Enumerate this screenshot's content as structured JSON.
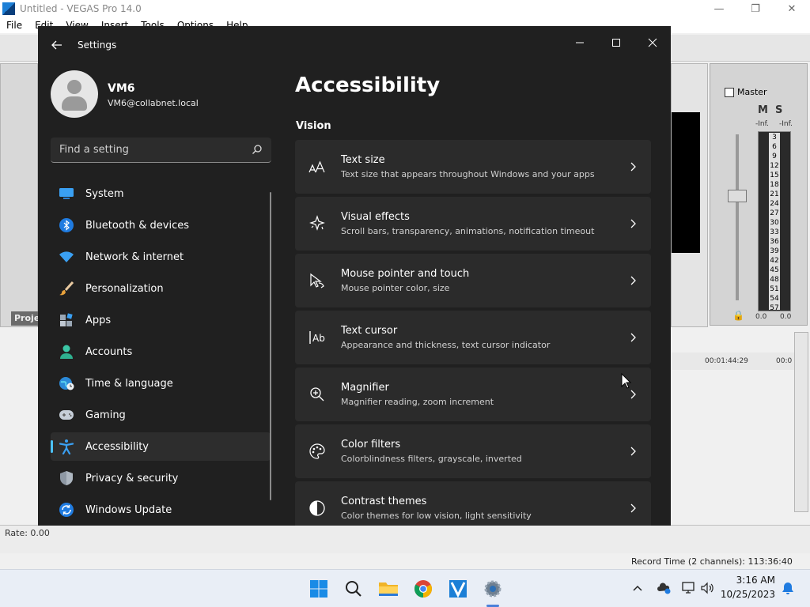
{
  "vegas": {
    "title": "Untitled - VEGAS Pro 14.0",
    "menu": [
      "File",
      "Edit",
      "View",
      "Insert",
      "Tools",
      "Options",
      "Help"
    ],
    "project_tab": "Proje",
    "master_label": "Master",
    "mute_label": "M",
    "solo_label": "S",
    "inf_left": "-Inf.",
    "inf_right": "-Inf.",
    "meter_scale": [
      "3",
      "6",
      "9",
      "12",
      "15",
      "18",
      "21",
      "24",
      "27",
      "30",
      "33",
      "36",
      "39",
      "42",
      "45",
      "48",
      "51",
      "54",
      "57"
    ],
    "meter_left_value": "0.0",
    "meter_right_value": "0.0",
    "timeline_time": "00:01:44:29",
    "timeline_time_2": "00:0",
    "rate_label": "Rate: 0.00",
    "record_time": "Record Time (2 channels): 113:36:40"
  },
  "settings": {
    "window_title": "Settings",
    "user": {
      "name": "VM6",
      "email": "VM6@collabnet.local"
    },
    "search_placeholder": "Find a setting",
    "nav": [
      {
        "label": "System",
        "icon": "monitor-icon"
      },
      {
        "label": "Bluetooth & devices",
        "icon": "bluetooth-icon"
      },
      {
        "label": "Network & internet",
        "icon": "wifi-icon"
      },
      {
        "label": "Personalization",
        "icon": "paintbrush-icon"
      },
      {
        "label": "Apps",
        "icon": "apps-icon"
      },
      {
        "label": "Accounts",
        "icon": "person-icon"
      },
      {
        "label": "Time & language",
        "icon": "globe-clock-icon"
      },
      {
        "label": "Gaming",
        "icon": "gamepad-icon"
      },
      {
        "label": "Accessibility",
        "icon": "accessibility-icon",
        "active": true
      },
      {
        "label": "Privacy & security",
        "icon": "shield-icon"
      },
      {
        "label": "Windows Update",
        "icon": "update-icon"
      }
    ],
    "page_title": "Accessibility",
    "section_title": "Vision",
    "cards": [
      {
        "title": "Text size",
        "desc": "Text size that appears throughout Windows and your apps",
        "icon": "text-size-icon"
      },
      {
        "title": "Visual effects",
        "desc": "Scroll bars, transparency, animations, notification timeout",
        "icon": "sparkle-icon"
      },
      {
        "title": "Mouse pointer and touch",
        "desc": "Mouse pointer color, size",
        "icon": "pointer-icon"
      },
      {
        "title": "Text cursor",
        "desc": "Appearance and thickness, text cursor indicator",
        "icon": "text-cursor-icon"
      },
      {
        "title": "Magnifier",
        "desc": "Magnifier reading, zoom increment",
        "icon": "magnifier-icon"
      },
      {
        "title": "Color filters",
        "desc": "Colorblindness filters, grayscale, inverted",
        "icon": "palette-icon"
      },
      {
        "title": "Contrast themes",
        "desc": "Color themes for low vision, light sensitivity",
        "icon": "contrast-icon"
      }
    ],
    "accent_color": "#4cc2ff"
  },
  "taskbar": {
    "time": "3:16 AM",
    "date": "10/25/2023",
    "apps": [
      "windows-start-icon",
      "search-icon",
      "file-explorer-icon",
      "chrome-icon",
      "vegas-icon",
      "settings-gear-icon"
    ]
  }
}
